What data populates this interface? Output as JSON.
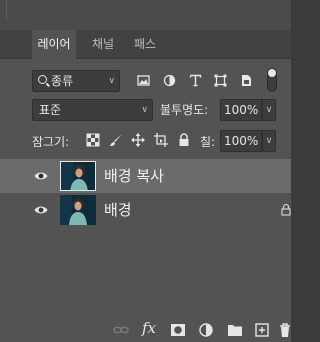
{
  "tabs": [
    "레이어",
    "채널",
    "패스"
  ],
  "filter": {
    "label": "종류"
  },
  "blend": {
    "mode": "표준",
    "opacity_label": "불투명도:",
    "opacity_value": "100%"
  },
  "lock": {
    "label": "잠그기:",
    "fill_label": "칠:",
    "fill_value": "100%"
  },
  "layers": [
    {
      "name": "배경 복사",
      "selected": true,
      "locked": false
    },
    {
      "name": "배경",
      "selected": false,
      "locked": true
    }
  ],
  "footer": {
    "fx_label": "fx"
  },
  "colors": {
    "panel": "#535353",
    "selected_row": "#6b6b6b",
    "tab_bar": "#424242"
  }
}
